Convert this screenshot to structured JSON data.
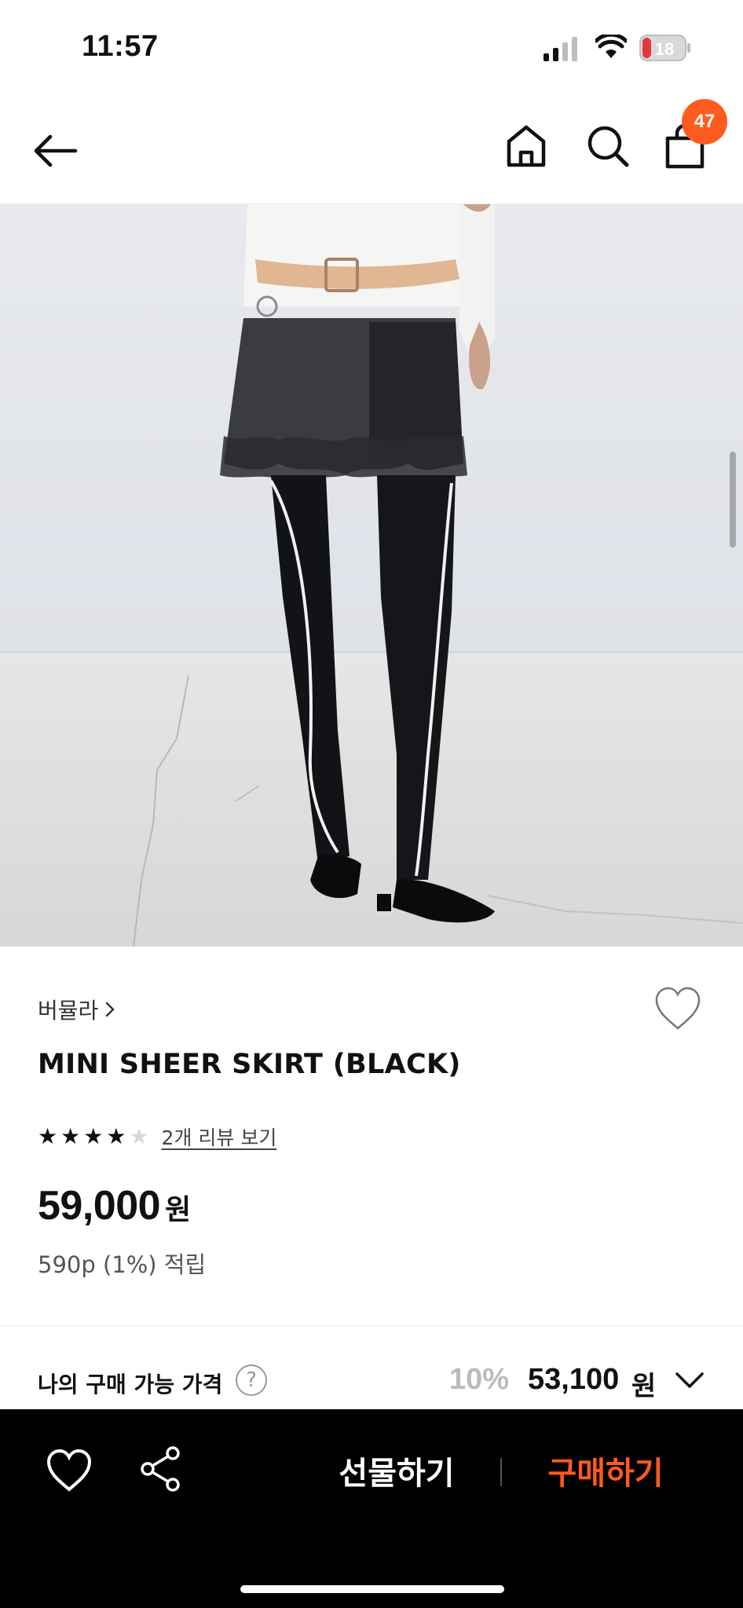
{
  "status_bar": {
    "time": "11:57",
    "battery_level": "18"
  },
  "nav": {
    "back_icon": "arrow-left-icon",
    "home_icon": "home-icon",
    "search_icon": "search-icon",
    "cart_icon": "shopping-bag-icon",
    "cart_count": "47",
    "accent_color": "#ff5a1f"
  },
  "product": {
    "brand": "버뮬라",
    "title": "MINI SHEER SKIRT (BLACK)",
    "rating": 4,
    "rating_max": 5,
    "review_link": "2개 리뷰 보기",
    "price": "59,000",
    "price_unit": "원",
    "points": "590p (1%) 적립"
  },
  "my_price": {
    "label": "나의 구매 가능 가격",
    "help": "?",
    "discount_rate": "10%",
    "discounted_price": "53,100",
    "unit": "원"
  },
  "bottom_bar": {
    "gift_label": "선물하기",
    "buy_label": "구매하기",
    "buy_color": "#ff5a1f"
  }
}
